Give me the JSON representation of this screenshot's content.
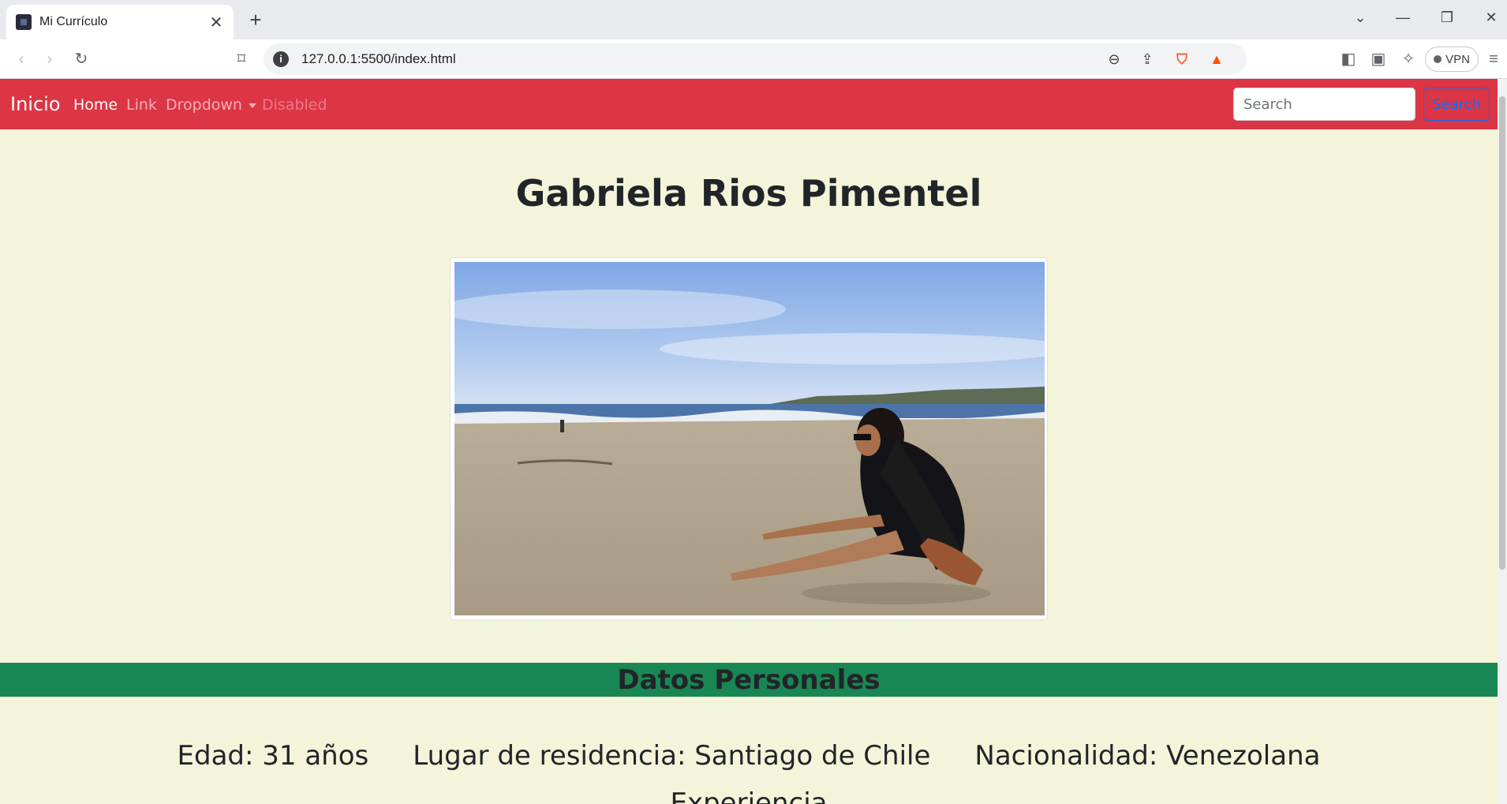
{
  "browser": {
    "tab_title": "Mi Currículo",
    "url": "127.0.0.1:5500/index.html",
    "vpn_label": "VPN"
  },
  "site_nav": {
    "brand": "Inicio",
    "links": [
      {
        "label": "Home",
        "state": "active"
      },
      {
        "label": "Link",
        "state": "normal"
      },
      {
        "label": "Dropdown",
        "state": "dropdown"
      },
      {
        "label": "Disabled",
        "state": "disabled"
      }
    ],
    "search_placeholder": "Search",
    "search_button": "Search",
    "bg_color": "#dc3545"
  },
  "profile": {
    "name": "Gabriela Rios Pimentel",
    "photo_icon": "beach-photo"
  },
  "personal_data": {
    "title": "Datos Personales",
    "bar_color": "#198754",
    "age": "Edad: 31 años",
    "residence": "Lugar de residencia: Santiago de Chile",
    "nationality": "Nacionalidad: Venezolana"
  },
  "next_section_partial": "Experiencia"
}
